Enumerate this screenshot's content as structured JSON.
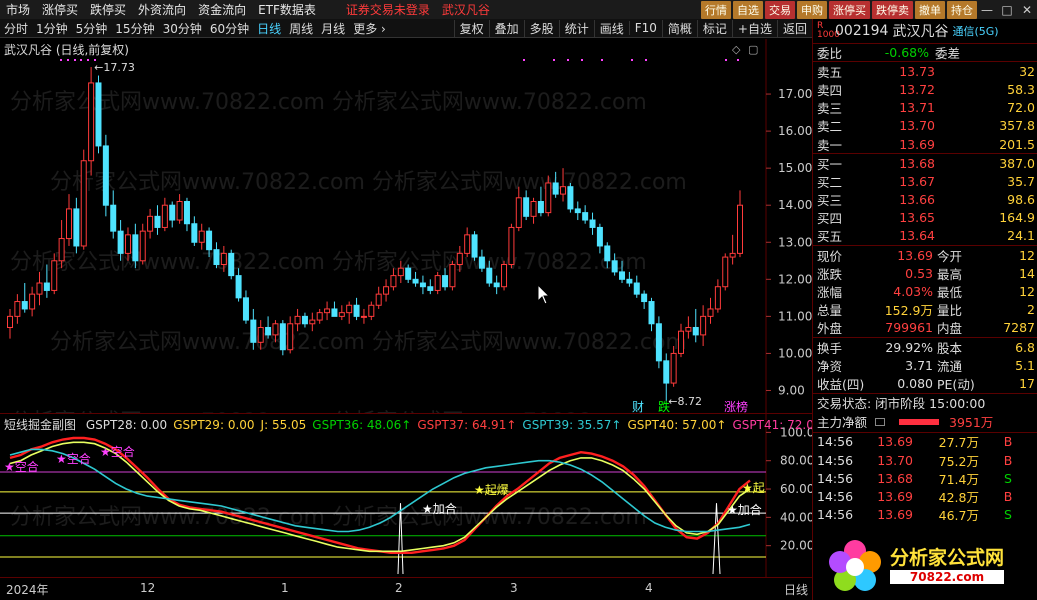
{
  "menu": [
    "市场",
    "涨停买",
    "跌停买",
    "外资流向",
    "资金流向",
    "ETF数据表"
  ],
  "menu_red": [
    "证券交易未登录",
    "武汉凡谷"
  ],
  "trade_buttons": [
    "行情",
    "自选",
    "交易",
    "申购",
    "涨停买",
    "跌停卖",
    "撤单",
    "持仓"
  ],
  "window_controls": [
    "—",
    "□",
    "✕"
  ],
  "periods": [
    "分时",
    "1分钟",
    "5分钟",
    "15分钟",
    "30分钟",
    "60分钟",
    "日线",
    "周线",
    "月线",
    "更多 ›"
  ],
  "active_period": "日线",
  "func_buttons": [
    "复权",
    "叠加",
    "多股",
    "统计",
    "画线",
    "F10",
    "简概",
    "标记",
    "+自选",
    "返回"
  ],
  "chart_title": "武汉凡谷 (日线,前复权)",
  "chart_data": [
    {
      "type": "candlestick",
      "title": "武汉凡谷 (日线,前复权)",
      "ylim": [
        8.5,
        18.0
      ],
      "y_ticks": [
        "17.00",
        "16.00",
        "15.00",
        "14.00",
        "13.00",
        "12.00",
        "11.00",
        "10.00",
        "9.00"
      ],
      "high_label": "17.73",
      "low_label": "8.72",
      "markers": [
        "财",
        "跌",
        "涨榜"
      ],
      "candles": [
        [
          10.7,
          11.2,
          10.4,
          11.0
        ],
        [
          11.0,
          11.6,
          10.8,
          11.4
        ],
        [
          11.4,
          11.9,
          11.1,
          11.2
        ],
        [
          11.2,
          11.8,
          11.0,
          11.6
        ],
        [
          11.6,
          12.2,
          11.3,
          11.9
        ],
        [
          11.9,
          12.4,
          11.5,
          11.7
        ],
        [
          11.7,
          12.7,
          11.6,
          12.5
        ],
        [
          12.5,
          13.6,
          12.3,
          13.1
        ],
        [
          13.1,
          14.3,
          12.9,
          13.9
        ],
        [
          13.9,
          14.2,
          12.7,
          12.9
        ],
        [
          12.9,
          15.5,
          12.8,
          15.2
        ],
        [
          15.2,
          17.73,
          14.8,
          17.3
        ],
        [
          17.3,
          17.5,
          15.4,
          15.6
        ],
        [
          15.6,
          15.9,
          13.7,
          14.0
        ],
        [
          14.0,
          14.4,
          13.1,
          13.3
        ],
        [
          13.3,
          13.6,
          12.5,
          12.7
        ],
        [
          12.7,
          13.4,
          12.5,
          13.2
        ],
        [
          13.2,
          13.5,
          12.3,
          12.5
        ],
        [
          12.5,
          13.5,
          12.4,
          13.3
        ],
        [
          13.3,
          13.9,
          13.1,
          13.7
        ],
        [
          13.7,
          14.0,
          13.2,
          13.4
        ],
        [
          13.4,
          14.2,
          13.3,
          14.0
        ],
        [
          14.0,
          14.1,
          13.4,
          13.6
        ],
        [
          13.6,
          14.3,
          13.5,
          14.1
        ],
        [
          14.1,
          14.2,
          13.3,
          13.5
        ],
        [
          13.5,
          13.7,
          12.9,
          13.0
        ],
        [
          13.0,
          13.5,
          12.8,
          13.3
        ],
        [
          13.3,
          13.4,
          12.6,
          12.8
        ],
        [
          12.8,
          13.0,
          12.3,
          12.4
        ],
        [
          12.4,
          12.9,
          12.2,
          12.7
        ],
        [
          12.7,
          12.8,
          12.0,
          12.1
        ],
        [
          12.1,
          12.3,
          11.4,
          11.5
        ],
        [
          11.5,
          11.7,
          10.8,
          10.9
        ],
        [
          10.9,
          11.2,
          10.1,
          10.3
        ],
        [
          10.3,
          10.9,
          10.1,
          10.7
        ],
        [
          10.7,
          11.0,
          10.4,
          10.5
        ],
        [
          10.5,
          10.9,
          10.3,
          10.8
        ],
        [
          10.8,
          10.9,
          9.95,
          10.1
        ],
        [
          10.1,
          11.0,
          10.0,
          10.8
        ],
        [
          10.8,
          11.2,
          10.6,
          11.0
        ],
        [
          11.0,
          11.1,
          10.7,
          10.8
        ],
        [
          10.8,
          11.1,
          10.6,
          10.9
        ],
        [
          10.9,
          11.2,
          10.8,
          11.1
        ],
        [
          11.1,
          11.4,
          10.9,
          11.2
        ],
        [
          11.2,
          11.4,
          11.0,
          11.0
        ],
        [
          11.0,
          11.3,
          10.9,
          11.1
        ],
        [
          11.1,
          11.4,
          10.8,
          11.3
        ],
        [
          11.3,
          11.5,
          10.9,
          11.0
        ],
        [
          11.0,
          11.2,
          10.8,
          11.0
        ],
        [
          11.0,
          11.4,
          10.9,
          11.3
        ],
        [
          11.3,
          11.8,
          11.2,
          11.6
        ],
        [
          11.6,
          12.0,
          11.4,
          11.8
        ],
        [
          11.8,
          12.3,
          11.7,
          12.1
        ],
        [
          12.1,
          12.5,
          11.9,
          12.3
        ],
        [
          12.3,
          12.4,
          11.9,
          12.0
        ],
        [
          12.0,
          12.2,
          11.8,
          11.9
        ],
        [
          11.9,
          12.1,
          11.6,
          11.8
        ],
        [
          11.8,
          12.0,
          11.6,
          11.7
        ],
        [
          11.7,
          12.2,
          11.6,
          12.1
        ],
        [
          12.1,
          12.3,
          11.7,
          11.8
        ],
        [
          11.8,
          12.5,
          11.7,
          12.4
        ],
        [
          12.4,
          12.9,
          12.2,
          12.7
        ],
        [
          12.7,
          13.4,
          12.6,
          13.2
        ],
        [
          13.2,
          13.3,
          12.5,
          12.6
        ],
        [
          12.6,
          12.8,
          12.2,
          12.3
        ],
        [
          12.3,
          12.5,
          11.8,
          11.9
        ],
        [
          11.9,
          12.1,
          11.6,
          11.8
        ],
        [
          11.8,
          12.5,
          11.7,
          12.4
        ],
        [
          12.4,
          13.5,
          12.3,
          13.4
        ],
        [
          13.4,
          14.5,
          13.3,
          14.2
        ],
        [
          14.2,
          14.4,
          13.6,
          13.7
        ],
        [
          13.7,
          14.2,
          13.5,
          14.1
        ],
        [
          14.1,
          14.5,
          13.7,
          13.8
        ],
        [
          13.8,
          14.8,
          13.7,
          14.6
        ],
        [
          14.6,
          14.9,
          14.2,
          14.3
        ],
        [
          14.3,
          15.0,
          14.1,
          14.5
        ],
        [
          14.5,
          14.6,
          13.8,
          13.9
        ],
        [
          13.9,
          14.1,
          13.6,
          13.8
        ],
        [
          13.8,
          14.0,
          13.5,
          13.6
        ],
        [
          13.6,
          13.8,
          13.2,
          13.4
        ],
        [
          13.4,
          13.5,
          12.7,
          12.9
        ],
        [
          12.9,
          13.0,
          12.3,
          12.5
        ],
        [
          12.5,
          12.7,
          12.1,
          12.2
        ],
        [
          12.2,
          12.5,
          11.9,
          12.0
        ],
        [
          12.0,
          12.2,
          11.8,
          11.9
        ],
        [
          11.9,
          12.1,
          11.5,
          11.6
        ],
        [
          11.6,
          11.7,
          11.2,
          11.4
        ],
        [
          11.4,
          11.5,
          10.6,
          10.8
        ],
        [
          10.8,
          11.0,
          9.6,
          9.8
        ],
        [
          9.8,
          10.0,
          8.72,
          9.2
        ],
        [
          9.2,
          10.2,
          9.1,
          10.0
        ],
        [
          10.0,
          10.8,
          9.9,
          10.6
        ],
        [
          10.6,
          11.0,
          10.4,
          10.7
        ],
        [
          10.7,
          11.2,
          10.3,
          10.5
        ],
        [
          10.5,
          11.3,
          10.2,
          11.0
        ],
        [
          11.0,
          11.5,
          10.8,
          11.2
        ],
        [
          11.2,
          12.0,
          11.1,
          11.8
        ],
        [
          11.8,
          12.7,
          11.7,
          12.6
        ],
        [
          12.6,
          13.2,
          12.4,
          12.7
        ],
        [
          12.7,
          14.4,
          12.6,
          14.0
        ]
      ]
    },
    {
      "type": "line",
      "title": "短线掘金副图",
      "ylim": [
        0,
        100
      ],
      "y_ticks": [
        "100.0",
        "80.00",
        "60.00",
        "40.00",
        "20.00"
      ],
      "x_labels": [
        "2024年",
        "12",
        "1",
        "2",
        "3",
        "4",
        "日线"
      ],
      "series": [
        {
          "name": "GSPT28",
          "value": "0.00"
        },
        {
          "name": "GSPT29",
          "value": "0.00"
        },
        {
          "name": "J",
          "value": "55.05"
        },
        {
          "name": "GSPT36",
          "value": "48.06"
        },
        {
          "name": "GSPT37",
          "value": "64.91"
        },
        {
          "name": "GSPT39",
          "value": "35.57"
        },
        {
          "name": "GSPT40",
          "value": "57.00"
        },
        {
          "name": "GSPT41",
          "value": "72.0"
        }
      ],
      "lines": {
        "red": [
          82,
          84,
          88,
          90,
          93,
          95,
          96,
          96,
          95,
          92,
          88,
          82,
          75,
          68,
          60,
          53,
          49,
          47,
          46,
          45,
          44,
          42,
          40,
          38,
          36,
          34,
          32,
          30,
          28,
          26,
          24,
          22,
          20,
          18,
          17,
          16,
          15,
          15,
          15,
          16,
          17,
          18,
          20,
          24,
          32,
          40,
          48,
          55,
          60,
          66,
          72,
          78,
          82,
          84,
          86,
          85,
          83,
          80,
          76,
          70,
          62,
          52,
          42,
          32,
          26,
          25,
          29,
          36,
          48,
          60,
          66
        ],
        "yellow": [
          78,
          80,
          84,
          87,
          90,
          92,
          93,
          93,
          92,
          89,
          85,
          79,
          72,
          65,
          58,
          52,
          48,
          46,
          45,
          43,
          41,
          39,
          37,
          35,
          33,
          31,
          29,
          27,
          25,
          23,
          21,
          19,
          18,
          17,
          16,
          16,
          16,
          16,
          17,
          18,
          19,
          20,
          22,
          26,
          33,
          40,
          47,
          53,
          58,
          63,
          68,
          73,
          77,
          80,
          82,
          82,
          80,
          77,
          73,
          67,
          60,
          51,
          42,
          34,
          29,
          28,
          30,
          35,
          45,
          55,
          60
        ],
        "cyan": [
          84,
          86,
          88,
          88,
          87,
          85,
          82,
          78,
          74,
          69,
          64,
          60,
          57,
          55,
          54,
          53,
          52,
          51,
          50,
          49,
          48,
          46,
          44,
          42,
          40,
          38,
          36,
          34,
          33,
          32,
          31,
          30,
          30,
          31,
          33,
          36,
          40,
          45,
          50,
          55,
          60,
          64,
          68,
          71,
          73,
          75,
          76,
          77,
          78,
          79,
          80,
          80,
          79,
          77,
          74,
          70,
          65,
          59,
          53,
          47,
          41,
          36,
          33,
          31,
          30,
          30,
          30,
          31,
          32,
          33,
          35
        ]
      },
      "annotations": [
        "空合",
        "空合",
        "空合",
        "起爆",
        "加合",
        "加合",
        "起"
      ]
    }
  ],
  "quote": {
    "badge": "R\n1000",
    "code": "002194",
    "name": "武汉凡谷",
    "tong": "通信(5G)",
    "weibi_label": "委比",
    "weibi": "-0.68%",
    "weicha_label": "委差",
    "sells": [
      {
        "label": "卖五",
        "price": "13.73",
        "vol": "32"
      },
      {
        "label": "卖四",
        "price": "13.72",
        "vol": "58.3"
      },
      {
        "label": "卖三",
        "price": "13.71",
        "vol": "72.0"
      },
      {
        "label": "卖二",
        "price": "13.70",
        "vol": "357.8"
      },
      {
        "label": "卖一",
        "price": "13.69",
        "vol": "201.5"
      }
    ],
    "buys": [
      {
        "label": "买一",
        "price": "13.68",
        "vol": "387.0"
      },
      {
        "label": "买二",
        "price": "13.67",
        "vol": "35.7"
      },
      {
        "label": "买三",
        "price": "13.66",
        "vol": "98.6"
      },
      {
        "label": "买四",
        "price": "13.65",
        "vol": "164.9"
      },
      {
        "label": "买五",
        "price": "13.64",
        "vol": "24.1"
      }
    ],
    "stats": [
      {
        "l1": "现价",
        "v1": "13.69",
        "c1": "red",
        "l2": "今开",
        "v2": "12",
        "c2": "green"
      },
      {
        "l1": "涨跌",
        "v1": "0.53",
        "c1": "red",
        "l2": "最高",
        "v2": "14",
        "c2": "red"
      },
      {
        "l1": "涨幅",
        "v1": "4.03%",
        "c1": "red",
        "l2": "最低",
        "v2": "12",
        "c2": "green"
      },
      {
        "l1": "总量",
        "v1": "152.9万",
        "c1": "yellow",
        "l2": "量比",
        "v2": "2",
        "c2": "red"
      },
      {
        "l1": "外盘",
        "v1": "799961",
        "c1": "red",
        "l2": "内盘",
        "v2": "7287",
        "c2": "green"
      }
    ],
    "stats2": [
      {
        "l1": "换手",
        "v1": "29.92%",
        "c1": "white",
        "l2": "股本",
        "v2": "6.8",
        "c2": "white"
      },
      {
        "l1": "净资",
        "v1": "3.71",
        "c1": "white",
        "l2": "流通",
        "v2": "5.1",
        "c2": "white"
      },
      {
        "l1": "收益(四)",
        "v1": "0.080",
        "c1": "white",
        "l2": "PE(动)",
        "v2": "17",
        "c2": "white"
      }
    ],
    "status": "交易状态: 闭市阶段 15:00:00",
    "mainflow_label": "主力净额",
    "mainflow_value": "3951万",
    "ticks": [
      {
        "t": "14:56",
        "p": "13.69",
        "v": "27.7万",
        "d": "B",
        "dc": "red"
      },
      {
        "t": "14:56",
        "p": "13.70",
        "v": "75.2万",
        "d": "B",
        "dc": "red"
      },
      {
        "t": "14:56",
        "p": "13.68",
        "v": "71.4万",
        "d": "S",
        "dc": "green"
      },
      {
        "t": "14:56",
        "p": "13.69",
        "v": "42.8万",
        "d": "B",
        "dc": "red"
      },
      {
        "t": "14:56",
        "p": "13.69",
        "v": "46.7万",
        "d": "S",
        "dc": "green"
      }
    ]
  },
  "logo_text": "分析家公式网",
  "logo_url": "70822.com",
  "watermark": "分析家公式网www.70822.com"
}
